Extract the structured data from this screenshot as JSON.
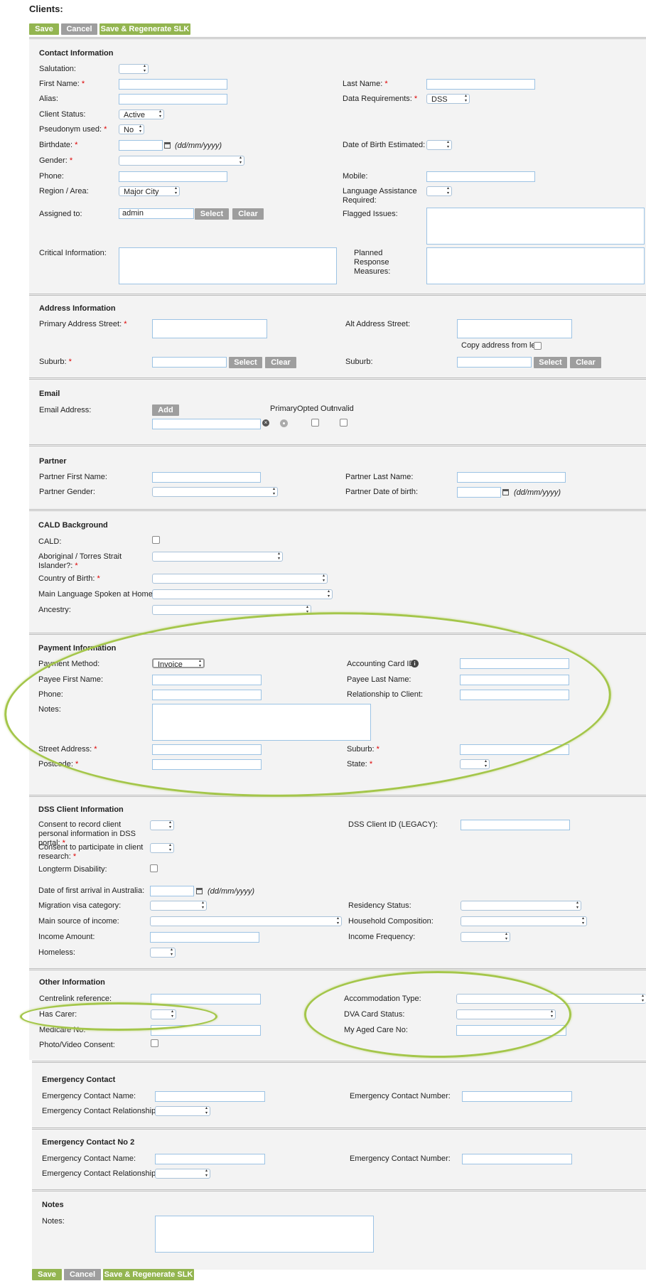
{
  "page": {
    "title": "Clients:"
  },
  "buttons": {
    "save": "Save",
    "cancel": "Cancel",
    "save_regen": "Save & Regenerate SLK",
    "select": "Select",
    "clear": "Clear",
    "add": "Add"
  },
  "contact": {
    "title": "Contact Information",
    "salutation": "Salutation:",
    "first_name": "First Name:",
    "last_name": "Last Name:",
    "alias": "Alias:",
    "data_requirements": "Data Requirements:",
    "data_requirements_value": "DSS",
    "client_status": "Client Status:",
    "client_status_value": "Active",
    "pseudonym": "Pseudonym used:",
    "pseudonym_value": "No",
    "birthdate": "Birthdate:",
    "date_format": "(dd/mm/yyyy)",
    "dob_estimated": "Date of Birth Estimated:",
    "gender": "Gender:",
    "phone": "Phone:",
    "mobile": "Mobile:",
    "region": "Region / Area:",
    "region_value": "Major City",
    "language_assist": "Language Assistance Required:",
    "assigned_to": "Assigned to:",
    "assigned_to_value": "admin",
    "flagged_issues": "Flagged Issues:",
    "critical_info": "Critical Information:",
    "planned_response": "Planned Response Measures:"
  },
  "address": {
    "title": "Address Information",
    "primary_street": "Primary Address Street:",
    "alt_street": "Alt Address Street:",
    "copy_address": "Copy address from left:",
    "suburb": "Suburb:",
    "alt_suburb": "Suburb:"
  },
  "email": {
    "title": "Email",
    "address": "Email Address:",
    "primary": "Primary",
    "opted_out": "Opted Out",
    "invalid": "Invalid"
  },
  "partner": {
    "title": "Partner",
    "first_name": "Partner First Name:",
    "last_name": "Partner Last Name:",
    "gender": "Partner Gender:",
    "dob": "Partner Date of birth:"
  },
  "cald": {
    "title": "CALD Background",
    "cald": "CALD:",
    "aboriginal": "Aboriginal / Torres Strait Islander?:",
    "country_birth": "Country of Birth:",
    "main_language": "Main Language Spoken at Home:",
    "ancestry": "Ancestry:"
  },
  "payment": {
    "title": "Payment Information",
    "method": "Payment Method:",
    "method_value": "Invoice",
    "accounting_id": "Accounting Card ID:",
    "payee_first": "Payee First Name:",
    "payee_last": "Payee Last Name:",
    "phone": "Phone:",
    "relationship": "Relationship to Client:",
    "notes": "Notes:",
    "street": "Street Address:",
    "suburb": "Suburb:",
    "postcode": "Postcode:",
    "state": "State:"
  },
  "dss": {
    "title": "DSS Client Information",
    "consent_record": "Consent to record client personal information in DSS portal:",
    "dss_id": "DSS Client ID (LEGACY):",
    "consent_research": "Consent to participate in client research:",
    "longterm": "Longterm Disability:",
    "first_arrival": "Date of first arrival in Australia:",
    "migration": "Migration visa category:",
    "residency": "Residency Status:",
    "income_source": "Main source of income:",
    "household": "Household Composition:",
    "income_amount": "Income Amount:",
    "income_frequency": "Income Frequency:",
    "homeless": "Homeless:"
  },
  "other": {
    "title": "Other Information",
    "centrelink": "Centrelink reference:",
    "accommodation": "Accommodation Type:",
    "has_carer": "Has Carer:",
    "dva_card": "DVA Card Status:",
    "medicare": "Medicare No:",
    "aged_care": "My Aged Care No:",
    "photo_consent": "Photo/Video Consent:"
  },
  "emergency1": {
    "title": "Emergency Contact",
    "name": "Emergency Contact Name:",
    "number": "Emergency Contact Number:",
    "relationship": "Emergency Contact Relationship:"
  },
  "emergency2": {
    "title": "Emergency Contact No 2",
    "name": "Emergency Contact Name:",
    "number": "Emergency Contact Number:",
    "relationship": "Emergency Contact Relationship:"
  },
  "notes": {
    "title": "Notes",
    "label": "Notes:"
  },
  "colors": {
    "accent_green": "#93b550",
    "button_gray": "#9e9e9e",
    "highlight_ellipse": "#a4c64a",
    "required": "#dd0000"
  }
}
